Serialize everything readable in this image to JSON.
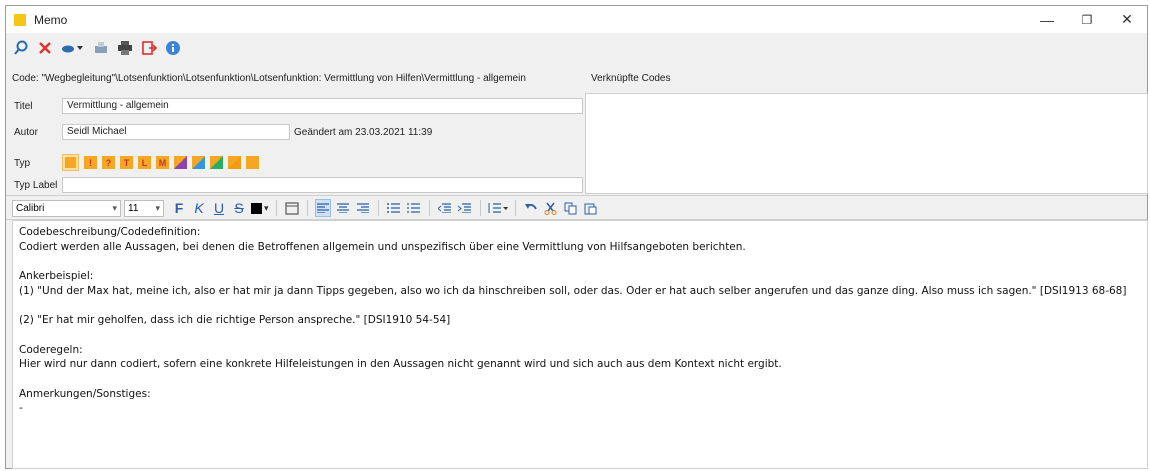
{
  "window": {
    "title": "Memo",
    "minimize": "—",
    "maximize": "❐",
    "close": "✕"
  },
  "code_line": "Code: \"Wegbegleitung\"\\Lotsenfunktion\\Lotsenfunktion\\Lotsenfunktion: Vermittlung von Hilfen\\Vermittlung - allgemein",
  "linked_codes_label": "Verknüpfte Codes",
  "form": {
    "title_label": "Titel",
    "title_value": "Vermittlung - allgemein",
    "author_label": "Autor",
    "author_value": "Seidl Michael",
    "changed_text": "Geändert am  23.03.2021 11:39",
    "type_label": "Typ",
    "type_label_label": "Typ Label",
    "type_label_value": "",
    "type_icons": [
      {
        "glyph": "",
        "color": "#f5a623"
      },
      {
        "glyph": "!",
        "color": "#f5a623"
      },
      {
        "glyph": "?",
        "color": "#f5a623"
      },
      {
        "glyph": "T",
        "color": "#f5a623"
      },
      {
        "glyph": "L",
        "color": "#f5a623"
      },
      {
        "glyph": "M",
        "color": "#f5a623"
      },
      {
        "glyph": "",
        "color": "#f5a623"
      },
      {
        "glyph": "",
        "color": "#f5a623"
      },
      {
        "glyph": "",
        "color": "#f5a623"
      },
      {
        "glyph": "",
        "color": "#f5a623"
      },
      {
        "glyph": "",
        "color": "#f5a623"
      }
    ]
  },
  "format": {
    "font": "Calibri",
    "size": "11"
  },
  "editor": {
    "lines": [
      "Codebeschreibung/Codedefinition:",
      "Codiert werden alle Aussagen, bei denen die Betroffenen allgemein und unspezifisch über eine Vermittlung von Hilfsangeboten berichten.",
      "",
      "Ankerbeispiel:",
      "(1) \"Und der Max hat, meine ich, also er hat mir ja dann Tipps gegeben, also wo ich da hinschreiben soll, oder das. Oder er hat auch selber angerufen und das ganze ding. Also muss ich sagen.\" [DSI1913 68-68]",
      "",
      "(2) \"Er hat mir geholfen, dass ich die richtige Person anspreche.\" [DSI1910 54-54]",
      "",
      "Coderegeln:",
      "Hier wird nur dann codiert, sofern eine konkrete Hilfeleistungen in den Aussagen nicht genannt wird  und sich auch aus dem Kontext nicht ergibt.",
      "",
      "Anmerkungen/Sonstiges:",
      "-"
    ]
  }
}
